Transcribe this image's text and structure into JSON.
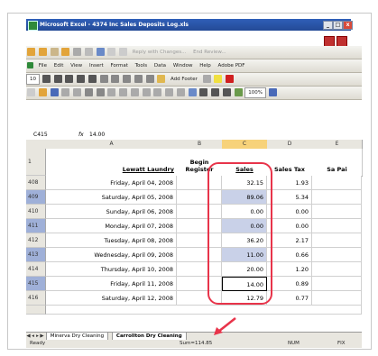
{
  "window": {
    "title": "Microsoft Excel - 4374 Inc Sales Deposits Log.xls",
    "buttons": {
      "minimize": "_",
      "restore": "□",
      "close": "x"
    }
  },
  "toolbar1": {
    "reply_label": "Reply with Changes...",
    "end_review_label": "End Review..."
  },
  "menu": {
    "items": [
      "File",
      "Edit",
      "View",
      "Insert",
      "Format",
      "Tools",
      "Data",
      "Window",
      "Help",
      "Adobe PDF"
    ]
  },
  "toolbar3": {
    "font_size": "10",
    "add_footer_label": "Add Footer"
  },
  "toolbar4": {
    "zoom": "100%"
  },
  "formula_bar": {
    "name_box": "C415",
    "fx": "fx",
    "value": "14.00"
  },
  "columns": {
    "A": "A",
    "B": "B",
    "C": "C",
    "D": "D",
    "E": "E"
  },
  "header_row": {
    "row_label": "1",
    "a": "Lewatt Laundry",
    "b": "Begin Register",
    "c": "Sales",
    "d": "Sales Tax",
    "e": "Sa Pai"
  },
  "rows": [
    {
      "num": "408",
      "date": "Friday, April 04, 2008",
      "sales": "32.15",
      "tax": "1.93"
    },
    {
      "num": "409",
      "date": "Saturday, April 05, 2008",
      "sales": "89.06",
      "tax": "5.34"
    },
    {
      "num": "410",
      "date": "Sunday, April 06, 2008",
      "sales": "0.00",
      "tax": "0.00"
    },
    {
      "num": "411",
      "date": "Monday, April 07, 2008",
      "sales": "0.00",
      "tax": "0.00"
    },
    {
      "num": "412",
      "date": "Tuesday, April 08, 2008",
      "sales": "36.20",
      "tax": "2.17"
    },
    {
      "num": "413",
      "date": "Wednesday, April 09, 2008",
      "sales": "11.00",
      "tax": "0.66"
    },
    {
      "num": "414",
      "date": "Thursday, April 10, 2008",
      "sales": "20.00",
      "tax": "1.20"
    },
    {
      "num": "415",
      "date": "Friday, April 11, 2008",
      "sales": "14.00",
      "tax": "0.89"
    },
    {
      "num": "416",
      "date": "Saturday, April 12, 2008",
      "sales": "12.79",
      "tax": "0.77"
    }
  ],
  "sheet_tabs": {
    "tab1": "Minerva Dry Cleaning",
    "tab2": "Carrollton Dry Cleaning"
  },
  "status": {
    "ready": "Ready",
    "sum": "Sum=114.85",
    "num": "NUM",
    "fix": "FIX"
  }
}
